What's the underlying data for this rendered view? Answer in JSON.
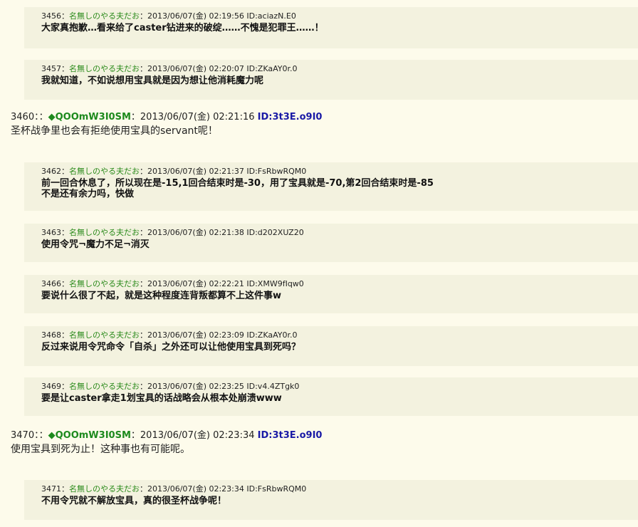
{
  "posts": [
    {
      "kind": "reply",
      "num": "3456",
      "sep": "：",
      "name": "名無しのやる夫だお",
      "sep2": "：",
      "date": "2013/06/07(金) 02:19:56",
      "id": "ID:aciazN.E0",
      "lines": [
        "大家真抱歉…看来给了caster钻进来的破绽……不愧是犯罪王……！"
      ]
    },
    {
      "kind": "reply",
      "num": "3457",
      "sep": "：",
      "name": "名無しのやる夫だお",
      "sep2": "：",
      "date": "2013/06/07(金) 02:20:07",
      "id": "ID:ZKaAY0r.0",
      "lines": [
        "我就知道，不如说想用宝具就是因为想让他消耗魔力呢"
      ]
    },
    {
      "kind": "op",
      "num": "3460",
      "sep": "：：",
      "diamond": "◆",
      "name": "QOOmW3I0SM",
      "sep2": "：",
      "date": "2013/06/07(金) 02:21:16",
      "id": "ID:3t3E.o9I0",
      "lines": [
        "圣杯战争里也会有拒绝使用宝具的servant呢！"
      ]
    },
    {
      "kind": "reply",
      "num": "3462",
      "sep": "：",
      "name": "名無しのやる夫だお",
      "sep2": "：",
      "date": "2013/06/07(金) 02:21:37",
      "id": "ID:FsRbwRQM0",
      "lines": [
        "前一回合休息了，所以现在是-15,1回合结束时是-30，用了宝具就是-70,第2回合结束时是-85",
        "不是还有余力吗，快做"
      ]
    },
    {
      "kind": "reply",
      "num": "3463",
      "sep": "：",
      "name": "名無しのやる夫だお",
      "sep2": "：",
      "date": "2013/06/07(金) 02:21:38",
      "id": "ID:d202XUZ20",
      "lines": [
        "使用令咒¬魔力不足¬消灭"
      ]
    },
    {
      "kind": "reply",
      "num": "3466",
      "sep": "：",
      "name": "名無しのやる夫だお",
      "sep2": "：",
      "date": "2013/06/07(金) 02:22:21",
      "id": "ID:XMW9fIqw0",
      "lines": [
        "要说什么很了不起，就是这种程度连背叛都算不上这件事w"
      ]
    },
    {
      "kind": "reply",
      "num": "3468",
      "sep": "：",
      "name": "名無しのやる夫だお",
      "sep2": "：",
      "date": "2013/06/07(金) 02:23:09",
      "id": "ID:ZKaAY0r.0",
      "lines": [
        "反过来说用令咒命令「自杀」之外还可以让他使用宝具到死吗？"
      ]
    },
    {
      "kind": "reply",
      "num": "3469",
      "sep": "：",
      "name": "名無しのやる夫だお",
      "sep2": "：",
      "date": "2013/06/07(金) 02:23:25",
      "id": "ID:v4.4ZTgk0",
      "lines": [
        "要是让caster拿走1划宝具的话战略会从根本处崩溃www"
      ]
    },
    {
      "kind": "op",
      "num": "3470",
      "sep": "：：",
      "diamond": "◆",
      "name": "QOOmW3I0SM",
      "sep2": "：",
      "date": "2013/06/07(金) 02:23:34",
      "id": "ID:3t3E.o9I0",
      "lines": [
        "使用宝具到死为止！这种事也有可能呢。"
      ]
    },
    {
      "kind": "reply",
      "num": "3471",
      "sep": "：",
      "name": "名無しのやる夫だお",
      "sep2": "：",
      "date": "2013/06/07(金) 02:23:34",
      "id": "ID:FsRbwRQM0",
      "lines": [
        "不用令咒就不解放宝具，真的很圣杯战争呢！"
      ]
    }
  ]
}
